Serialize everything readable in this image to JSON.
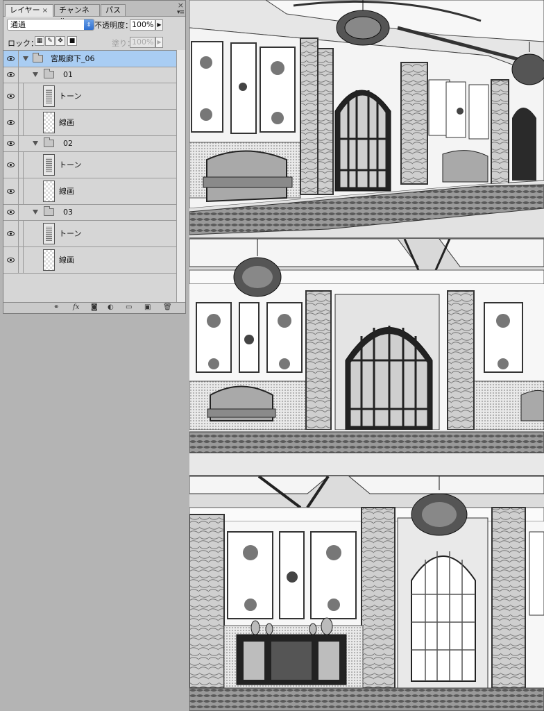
{
  "panel": {
    "tabs": [
      {
        "label": "レイヤー",
        "active": true,
        "close": "×"
      },
      {
        "label": "チャンネル",
        "active": false
      },
      {
        "label": "パス",
        "active": false
      }
    ],
    "close_glyph": "×",
    "menu_glyph": "▾≡",
    "blend_mode": "通過",
    "opacity_label": "不透明度：",
    "opacity_value": "100%",
    "lock_label": "ロック：",
    "fill_label": "塗り：",
    "fill_value": "100%",
    "layers": [
      {
        "name": "宮殿廊下_06",
        "type": "group",
        "level": 0,
        "selected": true
      },
      {
        "name": "01",
        "type": "group",
        "level": 1
      },
      {
        "name": "トーン",
        "type": "layer",
        "level": 2,
        "thumb": "tone"
      },
      {
        "name": "線画",
        "type": "layer",
        "level": 2,
        "thumb": "blank"
      },
      {
        "name": "02",
        "type": "group",
        "level": 1
      },
      {
        "name": "トーン",
        "type": "layer",
        "level": 2,
        "thumb": "tone"
      },
      {
        "name": "線画",
        "type": "layer",
        "level": 2,
        "thumb": "blank"
      },
      {
        "name": "03",
        "type": "group",
        "level": 1
      },
      {
        "name": "トーン",
        "type": "layer",
        "level": 2,
        "thumb": "tone"
      },
      {
        "name": "線画",
        "type": "layer",
        "level": 2,
        "thumb": "blank"
      }
    ],
    "footer_icons": [
      "link-icon",
      "fx-icon",
      "mask-icon",
      "adjustment-icon",
      "new-group-icon",
      "new-layer-icon",
      "trash-icon"
    ],
    "footer_fx": "fx"
  },
  "colors": {
    "selection": "#a9cdf3",
    "panel_bg": "#d6d6d6",
    "desktop_bg": "#b4b4b4"
  }
}
